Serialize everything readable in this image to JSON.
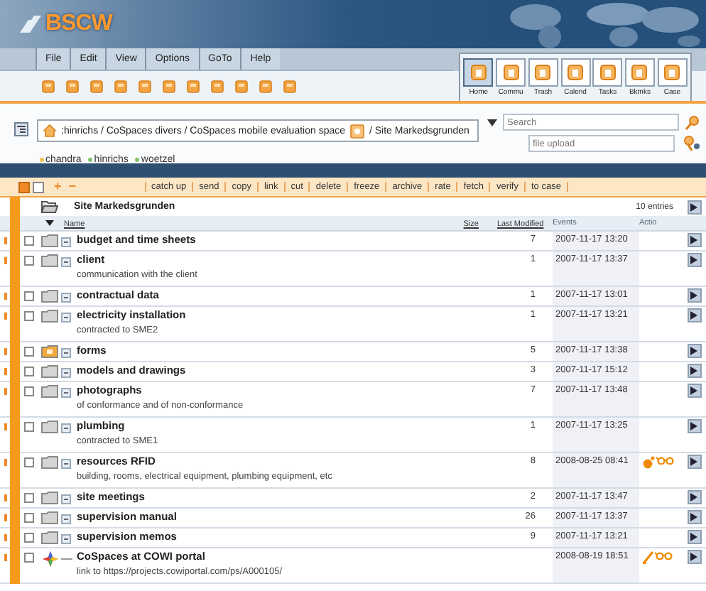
{
  "logo": "BSCW",
  "menu": [
    "File",
    "Edit",
    "View",
    "Options",
    "GoTo",
    "Help"
  ],
  "nav": [
    {
      "label": "Home",
      "selected": true
    },
    {
      "label": "Commu",
      "selected": false
    },
    {
      "label": "Trash",
      "selected": false
    },
    {
      "label": "Calend",
      "selected": false
    },
    {
      "label": "Tasks",
      "selected": false
    },
    {
      "label": "Bkmks",
      "selected": false
    },
    {
      "label": "Case",
      "selected": false
    }
  ],
  "breadcrumb": {
    "path": ":hinrichs / CoSpaces divers / CoSpaces mobile evaluation space",
    "current": "/ Site Markedsgrunden"
  },
  "search": {
    "placeholder": "Search"
  },
  "upload": {
    "placeholder": "file upload"
  },
  "members": [
    {
      "name": "chandra",
      "color": "#f0c24a"
    },
    {
      "name": "hinrichs",
      "color": "#7cc46a"
    },
    {
      "name": "woetzel",
      "color": "#7cc46a"
    }
  ],
  "action_bar": {
    "select_boxes": [
      {
        "checked": true
      },
      {
        "checked": false
      }
    ],
    "add": "+",
    "remove": "−",
    "buttons": [
      "catch up",
      "send",
      "copy",
      "link",
      "cut",
      "delete",
      "freeze",
      "archive",
      "rate",
      "fetch",
      "verify",
      "to case"
    ]
  },
  "folder": {
    "title": "Site Markedsgrunden",
    "count": "10 entries"
  },
  "columns": {
    "name": "Name",
    "size": "Size",
    "modified": "Last Modified",
    "events": "Events",
    "action": "Actio"
  },
  "rows": [
    {
      "kind": "folder",
      "checked": false,
      "name": "budget and time sheets",
      "size": "7",
      "modified": "2007-11-17 13:20",
      "events": []
    },
    {
      "kind": "folder",
      "checked": false,
      "name": "client",
      "description": "communication with the client",
      "size": "1",
      "modified": "2007-11-17 13:37",
      "events": []
    },
    {
      "kind": "folder",
      "checked": false,
      "name": "contractual data",
      "size": "1",
      "modified": "2007-11-17 13:01",
      "events": []
    },
    {
      "kind": "folder",
      "checked": false,
      "name": "electricity installation",
      "description": "contracted to SME2",
      "size": "1",
      "modified": "2007-11-17 13:21",
      "events": []
    },
    {
      "kind": "shared_folder",
      "checked": false,
      "name": "forms",
      "size": "5",
      "modified": "2007-11-17 13:38",
      "events": []
    },
    {
      "kind": "folder",
      "checked": false,
      "name": "models and drawings",
      "size": "3",
      "modified": "2007-11-17 15:12",
      "events": []
    },
    {
      "kind": "folder",
      "checked": false,
      "name": "photographs",
      "description": "of conformance and of non-conformance",
      "size": "7",
      "modified": "2007-11-17 13:48",
      "events": []
    },
    {
      "kind": "folder",
      "checked": false,
      "name": "plumbing",
      "description": "contracted to SME1",
      "size": "1",
      "modified": "2007-11-17 13:25",
      "events": []
    },
    {
      "kind": "folder",
      "checked": false,
      "name": "resources RFID",
      "description": "building, rooms, electrical equipment, plumbing equipment, etc",
      "size": "8",
      "modified": "2008-08-25 08:41",
      "events": [
        {
          "kind": "new"
        },
        {
          "kind": "read"
        }
      ]
    },
    {
      "kind": "folder",
      "checked": false,
      "name": "site meetings",
      "size": "2",
      "modified": "2007-11-17 13:47",
      "events": []
    },
    {
      "kind": "folder",
      "checked": false,
      "name": "supervision manual",
      "size": "26",
      "modified": "2007-11-17 13:37",
      "events": []
    },
    {
      "kind": "folder",
      "checked": false,
      "name": "supervision memos",
      "size": "9",
      "modified": "2007-11-17 13:21",
      "events": []
    },
    {
      "kind": "link",
      "checked": false,
      "name": "CoSpaces at COWI portal",
      "description": "link to https://projects.cowiportal.com/ps/A000105/",
      "modified": "2008-08-19 18:51",
      "events": [
        {
          "kind": "changed"
        },
        {
          "kind": "read"
        }
      ]
    }
  ]
}
